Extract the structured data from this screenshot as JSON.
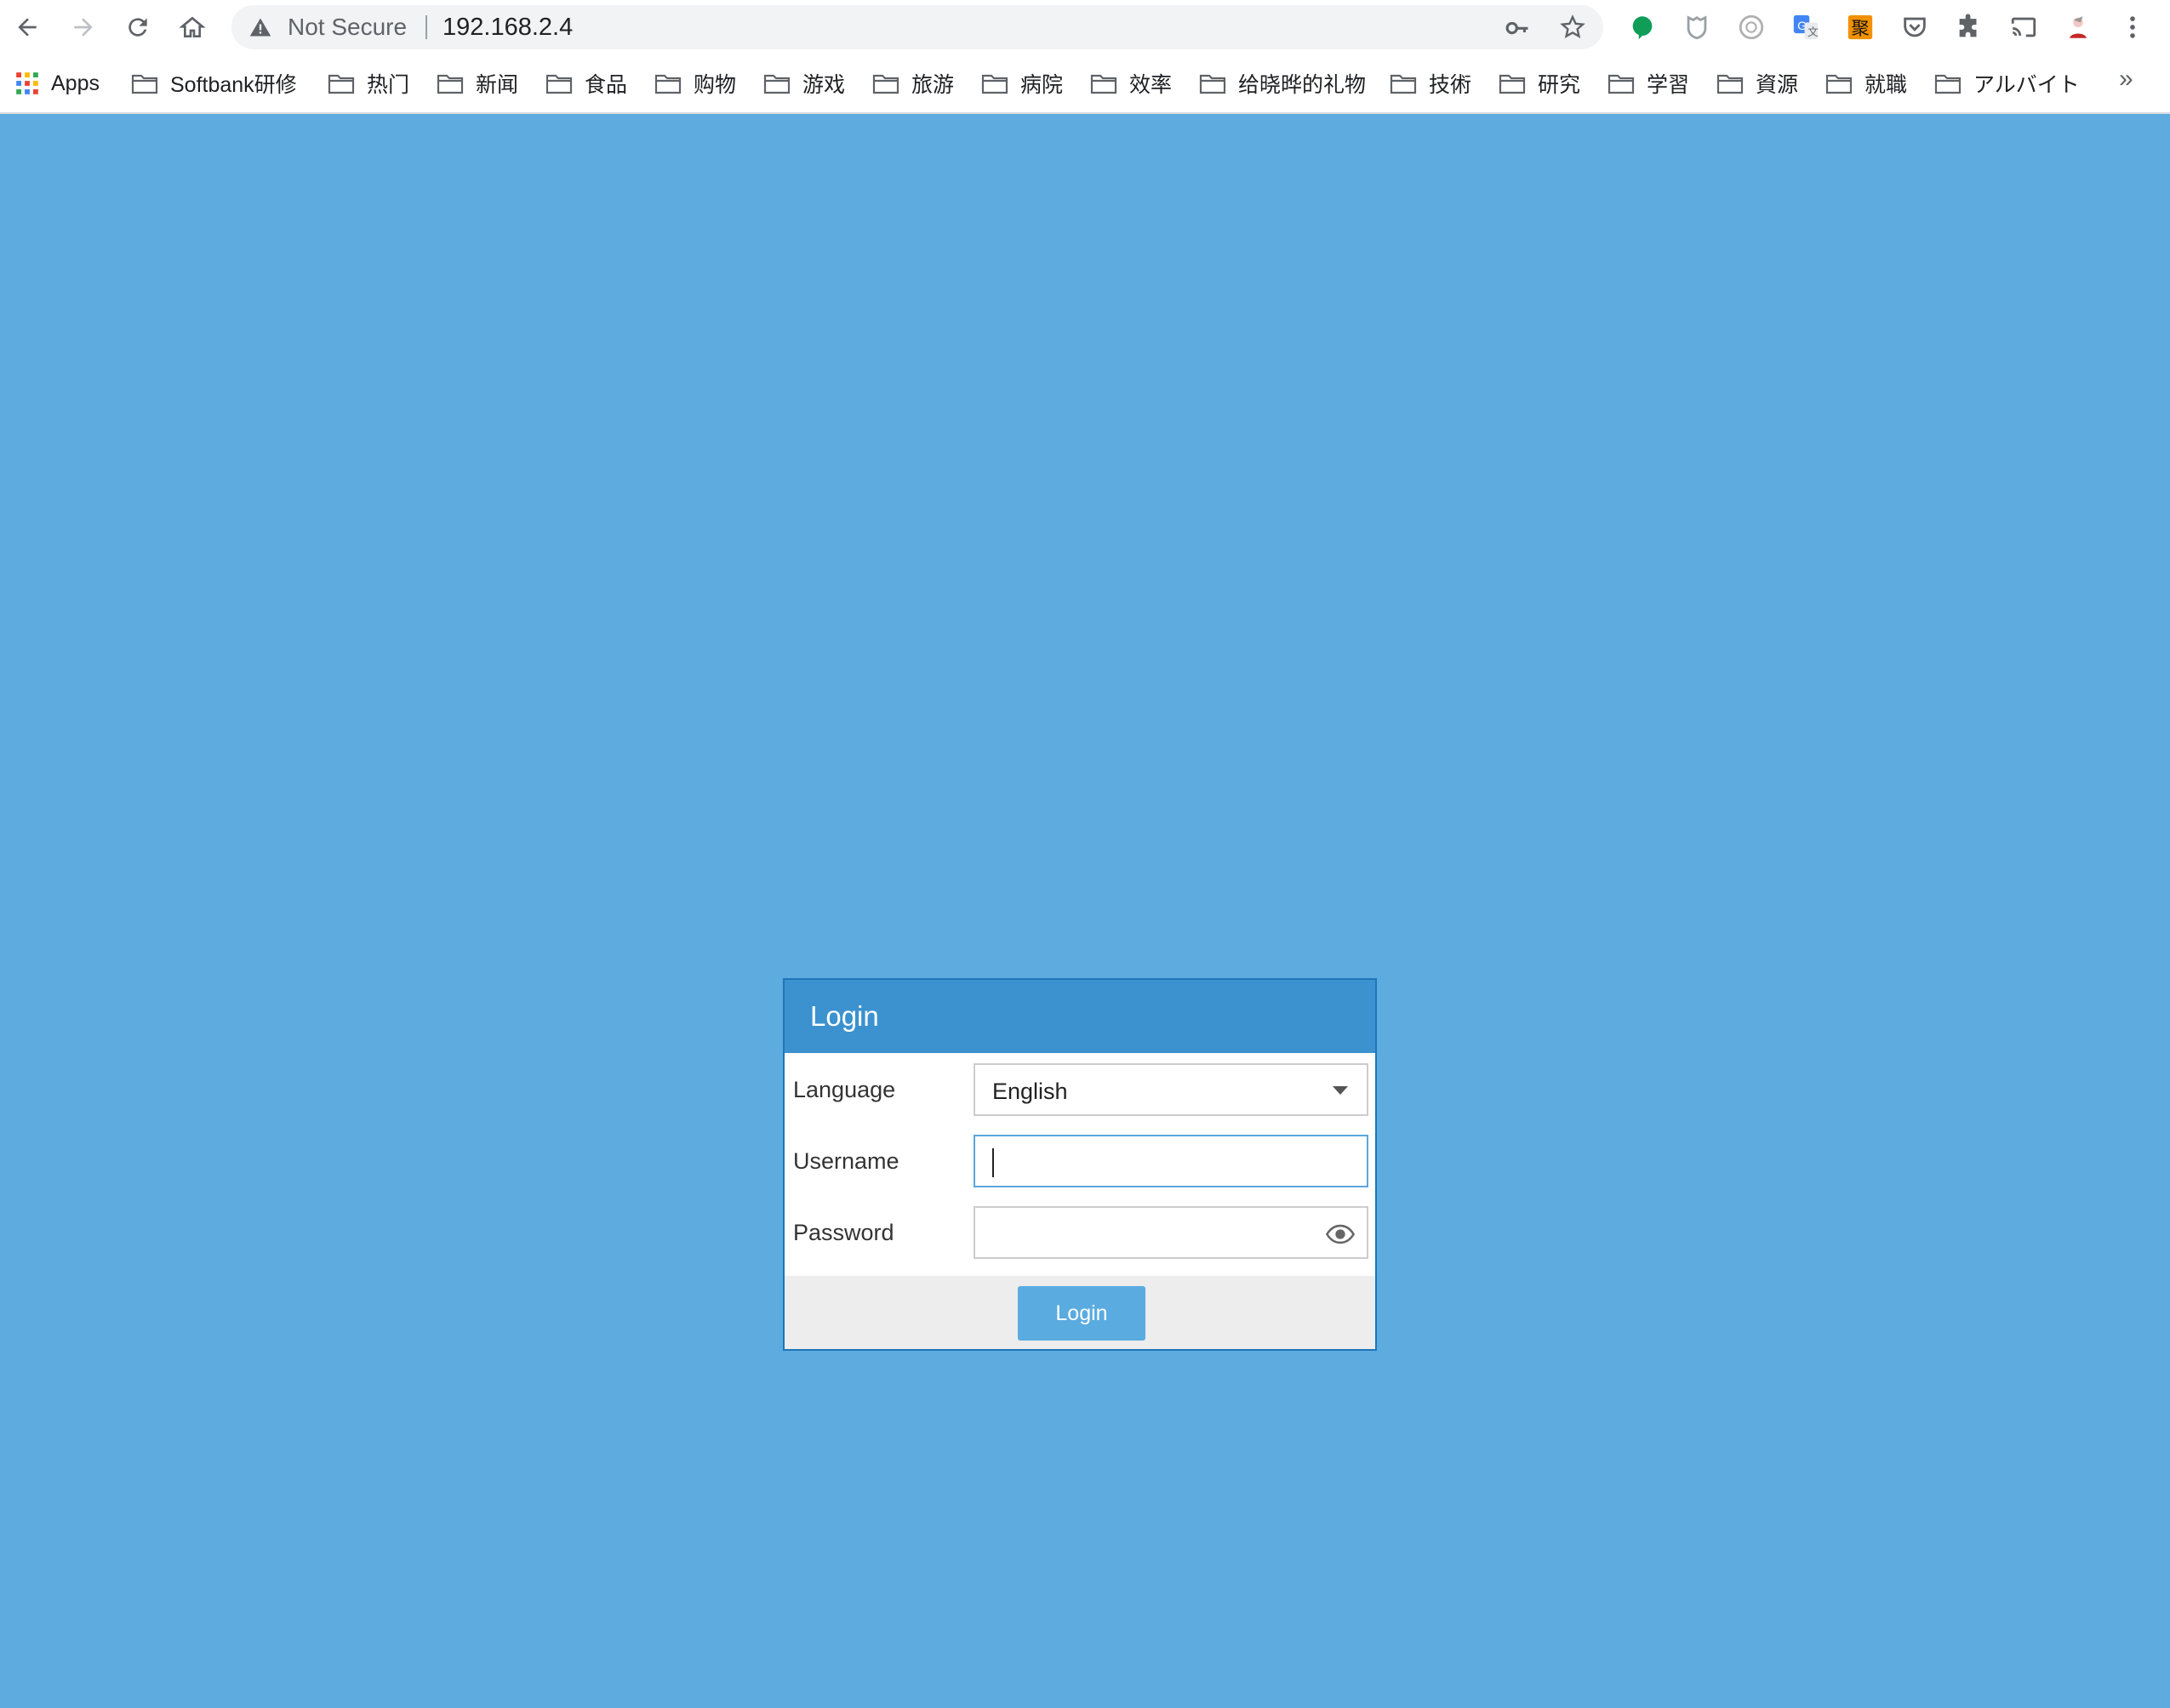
{
  "browser": {
    "security_label": "Not Secure",
    "url": "192.168.2.4"
  },
  "bookmarks": {
    "apps_label": "Apps",
    "items": [
      {
        "label": "Softbank研修"
      },
      {
        "label": "热门"
      },
      {
        "label": "新闻"
      },
      {
        "label": "食品"
      },
      {
        "label": "购物"
      },
      {
        "label": "游戏"
      },
      {
        "label": "旅游"
      },
      {
        "label": "病院"
      },
      {
        "label": "效率"
      },
      {
        "label": "给晓晔的礼物"
      },
      {
        "label": "技術"
      },
      {
        "label": "研究"
      },
      {
        "label": "学習"
      },
      {
        "label": "資源"
      },
      {
        "label": "就職"
      },
      {
        "label": "アルバイト"
      }
    ],
    "more_label": "»"
  },
  "extensions": {
    "ext5_label": "聚"
  },
  "login": {
    "title": "Login",
    "language_label": "Language",
    "language_value": "English",
    "username_label": "Username",
    "username_value": "",
    "password_label": "Password",
    "password_value": "",
    "button_label": "Login"
  },
  "colors": {
    "page_background": "#5dabdf",
    "dialog_header": "#3b92cf",
    "login_button": "#5aabe0"
  }
}
